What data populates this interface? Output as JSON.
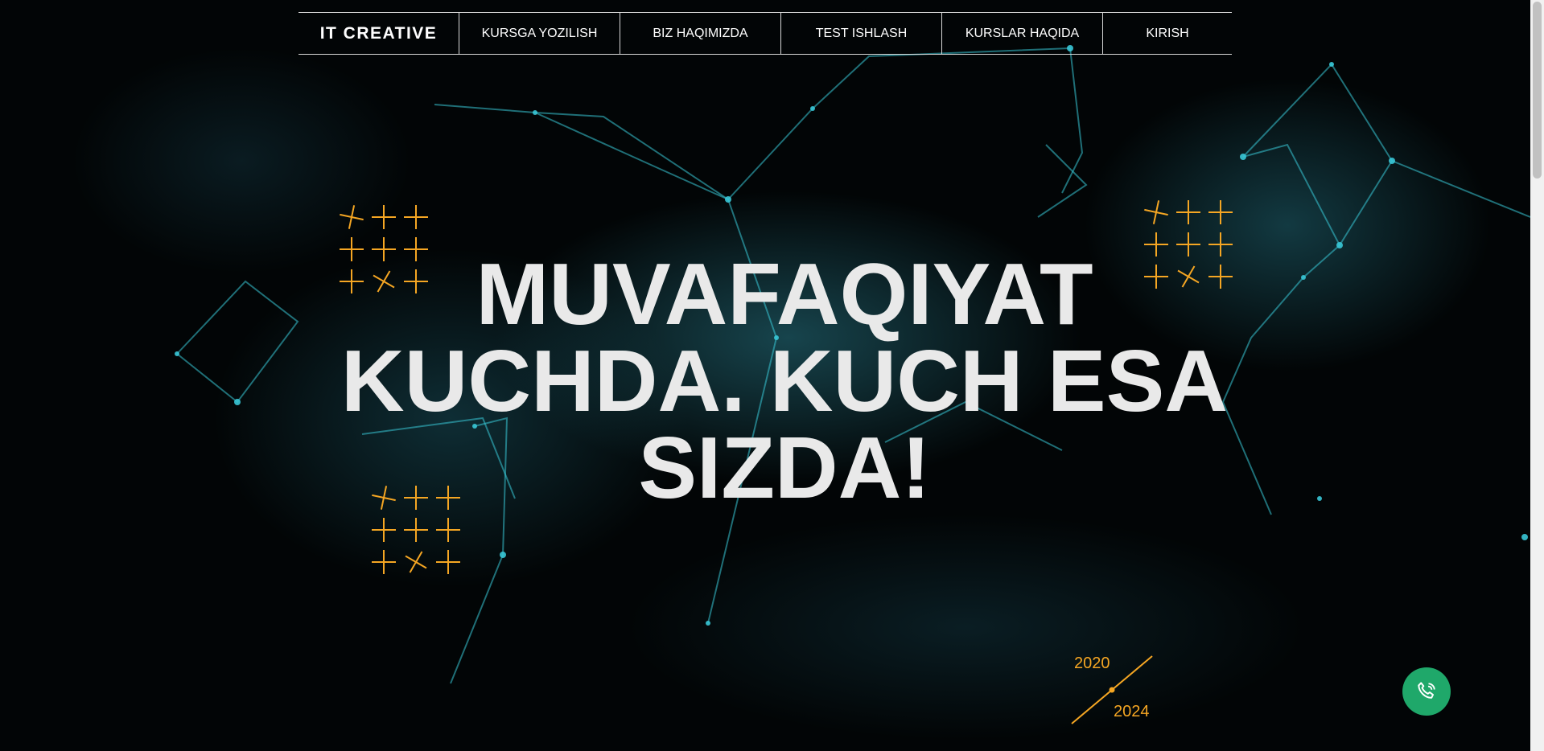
{
  "nav": {
    "brand": "IT CREATIVE",
    "items": [
      {
        "label": "KURSGA YOZILISH"
      },
      {
        "label": "BIZ HAQIMIZDA"
      },
      {
        "label": "TEST ISHLASH"
      },
      {
        "label": "KURSLAR HAQIDA"
      },
      {
        "label": "KIRISH"
      }
    ]
  },
  "hero": {
    "lines": [
      "MUVAFAQIYAT",
      "KUCHDA. KUCH ESA",
      "SIZDA!"
    ]
  },
  "years": {
    "start": "2020",
    "end": "2024"
  },
  "colors": {
    "accent": "#f5a623",
    "call_button": "#1fa86a",
    "network": "#39c7d6"
  },
  "icons": {
    "call": "phone-call-icon",
    "decor": "plus-cross-icon"
  }
}
